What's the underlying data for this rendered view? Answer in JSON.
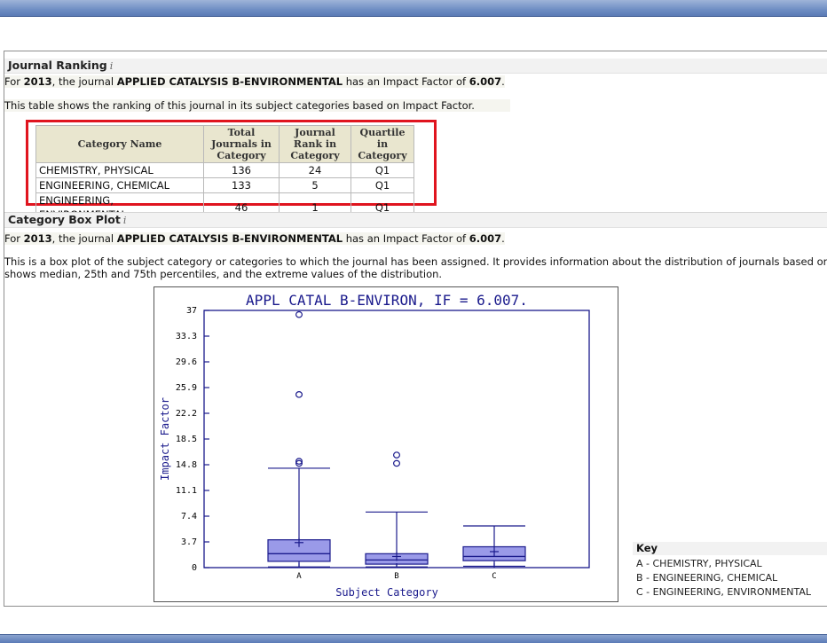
{
  "ranking": {
    "title": "Journal Ranking",
    "info_glyph": "i",
    "year_line": {
      "prefix": "For ",
      "year": "2013",
      "mid": ", the journal ",
      "journal": "APPLIED CATALYSIS B-ENVIRONMENTAL",
      "mid2": " has an Impact Factor of ",
      "if_value": "6.007",
      "suffix": "."
    },
    "description": "This table shows the ranking of this journal in its subject categories based on Impact Factor.",
    "table": {
      "headers": [
        "Category Name",
        "Total Journals in Category",
        "Journal Rank in Category",
        "Quartile in Category"
      ],
      "rows": [
        [
          "CHEMISTRY, PHYSICAL",
          "136",
          "24",
          "Q1"
        ],
        [
          "ENGINEERING, CHEMICAL",
          "133",
          "5",
          "Q1"
        ],
        [
          "ENGINEERING, ENVIRONMENTAL",
          "46",
          "1",
          "Q1"
        ]
      ]
    }
  },
  "boxplot": {
    "title": "Category Box Plot",
    "info_glyph": "i",
    "year_line": {
      "prefix": "For ",
      "year": "2013",
      "mid": ", the journal ",
      "journal": "APPLIED CATALYSIS B-ENVIRONMENTAL",
      "mid2": " has an Impact Factor of ",
      "if_value": "6.007",
      "suffix": "."
    },
    "description_1": "This is a box plot of the subject category or categories to which the journal has been assigned. It provides information about the distribution of journals based on Im",
    "description_2": "shows median, 25th and 75th percentiles, and the extreme values of the distribution.",
    "key": {
      "title": "Key",
      "items": [
        "A -  CHEMISTRY, PHYSICAL",
        "B -  ENGINEERING, CHEMICAL",
        "C -  ENGINEERING, ENVIRONMENTAL"
      ]
    }
  },
  "colors": {
    "box_fill": "#9a9ae8",
    "axis": "#1a1a8c",
    "highlight_border": "#e0141e",
    "header_bar": "#6f8ec4"
  },
  "chart_data": {
    "type": "boxplot",
    "title": "APPL CATAL B-ENVIRON, IF = 6.007.",
    "xlabel": "Subject Category",
    "ylabel": "Impact Factor",
    "yticks": [
      "37",
      "33.3",
      "29.6",
      "25.9",
      "22.2",
      "18.5",
      "14.8",
      "11.1",
      "7.4",
      "3.7",
      "0"
    ],
    "ylim": [
      0,
      37
    ],
    "categories": [
      "A",
      "B",
      "C"
    ],
    "boxes": [
      {
        "category": "A",
        "min": 0.1,
        "q1": 0.9,
        "median": 2.0,
        "q3": 4.0,
        "max": 14.3,
        "mean": 3.6,
        "outliers": [
          15.0,
          15.3,
          24.9,
          36.4
        ]
      },
      {
        "category": "B",
        "min": 0.1,
        "q1": 0.5,
        "median": 1.1,
        "q3": 2.0,
        "max": 8.0,
        "mean": 1.6,
        "outliers": [
          15.0,
          16.2
        ]
      },
      {
        "category": "C",
        "min": 0.2,
        "q1": 1.0,
        "median": 1.6,
        "q3": 3.0,
        "max": 6.0,
        "mean": 2.3,
        "outliers": []
      }
    ]
  }
}
